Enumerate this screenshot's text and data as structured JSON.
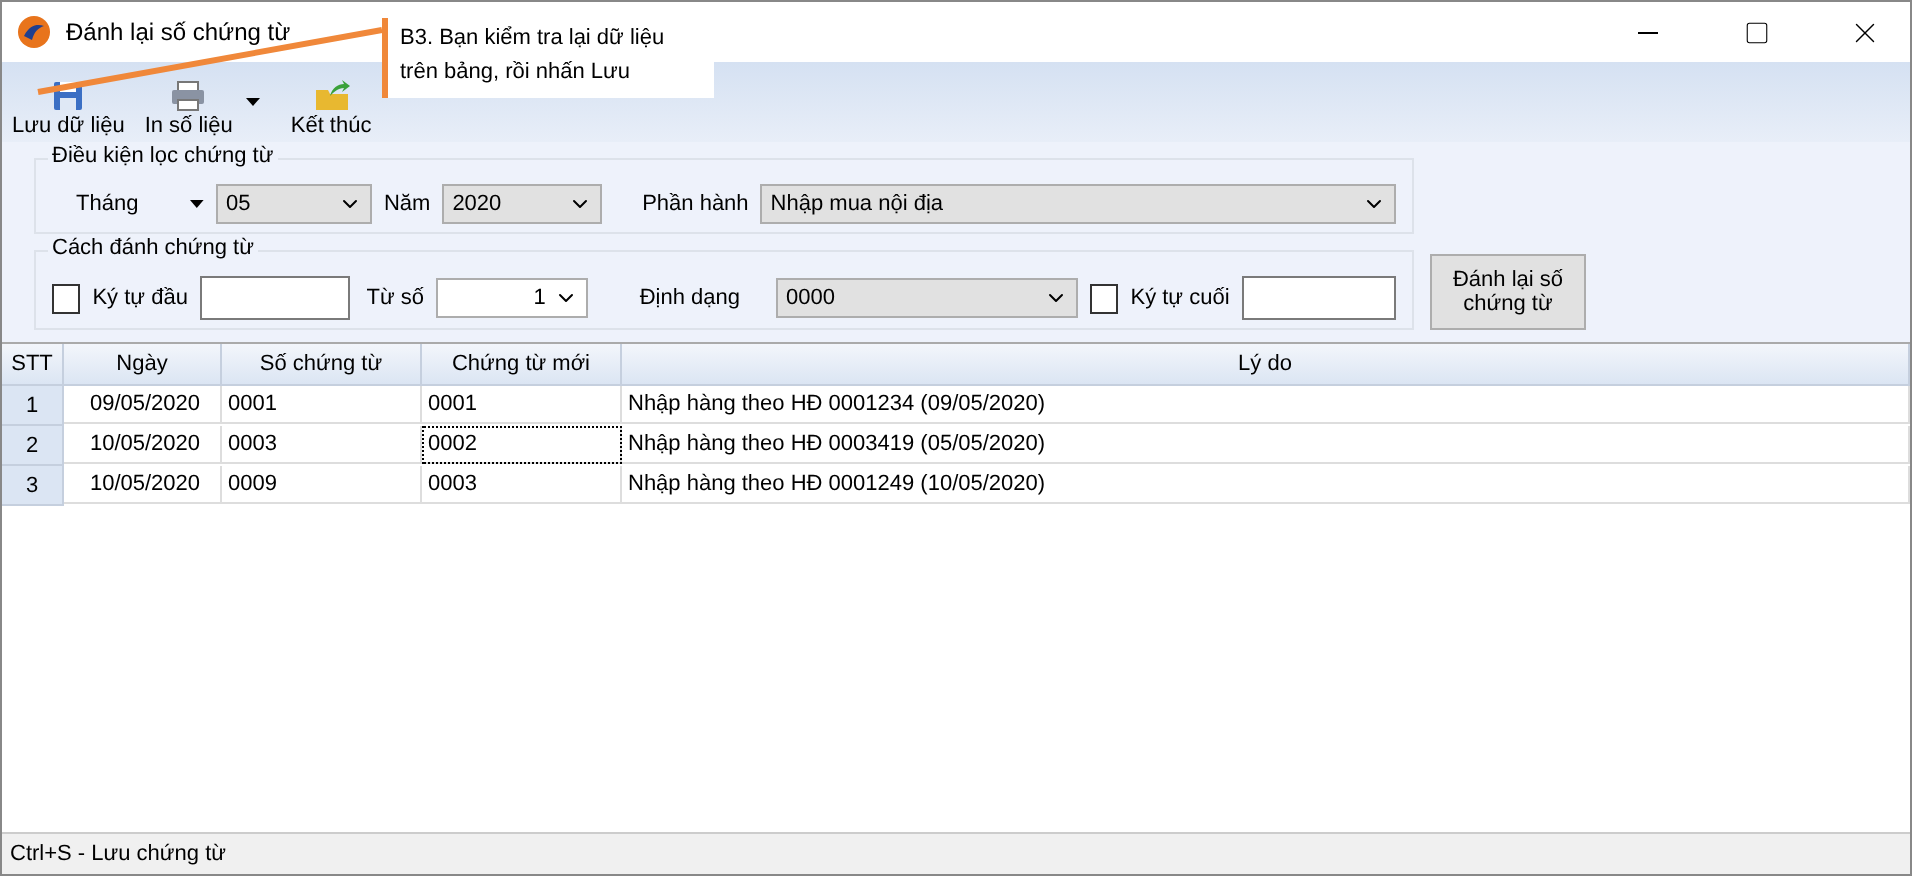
{
  "window": {
    "title": "Đánh lại số chứng từ"
  },
  "callout": {
    "text": "B3. Bạn kiểm tra lại  dữ liệu trên bảng, rồi nhấn Lưu"
  },
  "toolbar": [
    {
      "kind": "save",
      "label": "Lưu dữ liệu",
      "has_dropdown": false
    },
    {
      "kind": "print",
      "label": "In số liệu",
      "has_dropdown": true
    },
    {
      "kind": "exit",
      "label": "Kết thúc",
      "has_dropdown": false
    }
  ],
  "filter": {
    "title": "Điều kiện lọc chứng từ",
    "month_label": "Tháng",
    "month": "05",
    "year_label": "Năm",
    "year": "2020",
    "module_label": "Phần hành",
    "module": "Nhập mua nội địa"
  },
  "numbering": {
    "title": "Cách đánh chứng từ",
    "prefix_label": "Ký tự đầu",
    "prefix_checked": false,
    "from_label": "Từ số",
    "from": "1",
    "format_label": "Định dạng",
    "format": "0000",
    "suffix_label": "Ký tự cuối",
    "suffix_checked": false,
    "renumber_button": "Đánh lại số chứng từ"
  },
  "table": {
    "columns": [
      "STT",
      "Ngày",
      "Số chứng từ",
      "Chứng từ mới",
      "Lý do"
    ],
    "rows": [
      {
        "stt": "1",
        "date": "09/05/2020",
        "number": "0001",
        "new_number": "0001",
        "reason": "Nhập hàng theo HĐ 0001234 (09/05/2020)",
        "focused": false
      },
      {
        "stt": "2",
        "date": "10/05/2020",
        "number": "0003",
        "new_number": "0002",
        "reason": "Nhập hàng theo HĐ 0003419 (05/05/2020)",
        "focused": true
      },
      {
        "stt": "3",
        "date": "10/05/2020",
        "number": "0009",
        "new_number": "0003",
        "reason": "Nhập hàng theo HĐ 0001249 (10/05/2020)",
        "focused": false
      }
    ]
  },
  "status_bar": {
    "text": "Ctrl+S - Lưu chứng từ"
  }
}
